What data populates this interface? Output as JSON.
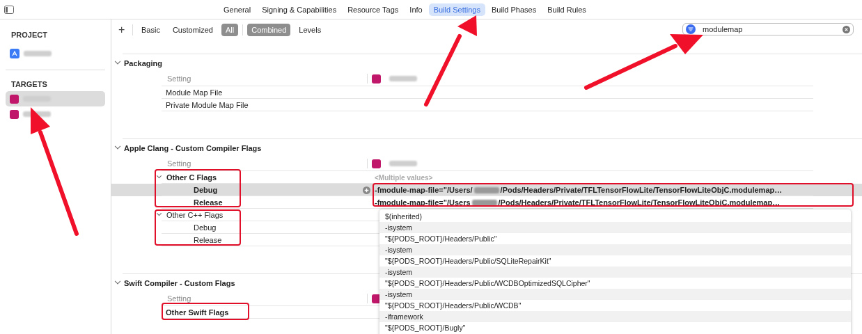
{
  "tabs": [
    {
      "label": "General",
      "selected": false
    },
    {
      "label": "Signing & Capabilities",
      "selected": false
    },
    {
      "label": "Resource Tags",
      "selected": false
    },
    {
      "label": "Info",
      "selected": false
    },
    {
      "label": "Build Settings",
      "selected": true
    },
    {
      "label": "Build Phases",
      "selected": false
    },
    {
      "label": "Build Rules",
      "selected": false
    }
  ],
  "sidebar": {
    "project_heading": "PROJECT",
    "targets_heading": "TARGETS",
    "targets": [
      {
        "selected": true
      },
      {
        "selected": false
      }
    ]
  },
  "filter_bar": {
    "add_label": "+",
    "scopes": [
      {
        "label": "Basic",
        "selected": false
      },
      {
        "label": "Customized",
        "selected": false
      },
      {
        "label": "All",
        "selected": true
      }
    ],
    "views": [
      {
        "label": "Combined",
        "selected": true
      },
      {
        "label": "Levels",
        "selected": false
      }
    ],
    "search": {
      "value": "modulemap"
    }
  },
  "sections": [
    {
      "title": "Packaging",
      "expanded": true,
      "column_header": "Setting",
      "settings": [
        {
          "name": "Module Map File",
          "customized": false
        },
        {
          "name": "Private Module Map File",
          "customized": false
        }
      ]
    },
    {
      "title": "Apple Clang - Custom Compiler Flags",
      "expanded": true,
      "column_header": "Setting",
      "settings": [
        {
          "name": "Other C Flags",
          "customized": true,
          "expanded": true,
          "value": "<Multiple values>",
          "children": [
            {
              "name": "Debug",
              "customized": true,
              "selected": true,
              "value_prefix": "-fmodule-map-file=\"/Users/",
              "value_suffix": "/Pods/Headers/Private/TFLTensorFlowLite/TensorFlowLiteObjC.modulemap…"
            },
            {
              "name": "Release",
              "customized": true,
              "selected": false,
              "value_prefix": "-fmodule-map-file=\"/Users",
              "value_suffix": "/Pods/Headers/Private/TFLTensorFlowLite/TensorFlowLiteObjC.modulemap…"
            }
          ]
        },
        {
          "name": "Other C++ Flags",
          "customized": false,
          "expanded": true,
          "children": [
            {
              "name": "Debug",
              "customized": false,
              "selected": false
            },
            {
              "name": "Release",
              "customized": false,
              "selected": false
            }
          ]
        }
      ]
    },
    {
      "title": "Swift Compiler - Custom Flags",
      "expanded": true,
      "column_header": "Setting",
      "settings": [
        {
          "name": "Other Swift Flags",
          "customized": true
        }
      ]
    }
  ],
  "popover": {
    "items": [
      "$(inherited)",
      "-isystem",
      "\"${PODS_ROOT}/Headers/Public\"",
      "-isystem",
      "\"${PODS_ROOT}/Headers/Public/SQLiteRepairKit\"",
      "-isystem",
      "\"${PODS_ROOT}/Headers/Public/WCDBOptimizedSQLCipher\"",
      "-isystem",
      "\"${PODS_ROOT}/Headers/Public/WCDB\"",
      "-iframework",
      "\"${PODS_ROOT}/Bugly\""
    ]
  }
}
